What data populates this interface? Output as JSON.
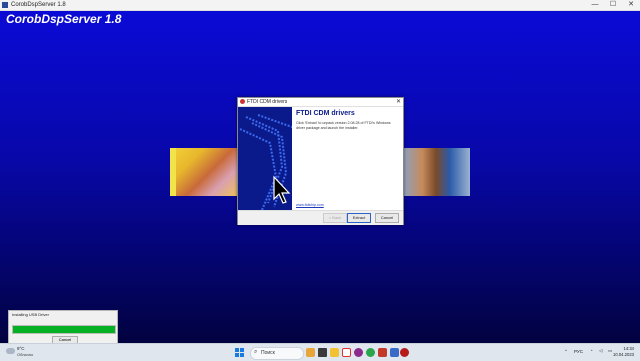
{
  "window": {
    "title": "CorobDspServer  1.8",
    "minimize": "—",
    "maximize": "☐",
    "close": "✕"
  },
  "desktop": {
    "app_name": "CorobDspServer  1.8"
  },
  "dialog": {
    "title": "FTDI CDM drivers",
    "close": "✕",
    "heading": "FTDI CDM drivers",
    "body": "Click 'Extract' to unpack version 2.08.28 of FTDI's Windows driver package and launch the installer.",
    "link": "www.ftdichip.com",
    "back_label": "< Back",
    "extract_label": "Extract",
    "cancel_label": "Cancel"
  },
  "installer": {
    "label": "Installing USB Driver",
    "progress": 1.0,
    "cancel_label": "Cancel"
  },
  "taskbar": {
    "weather_temp": "9°C",
    "weather_desc": "Облачно",
    "search_placeholder": "Поиск",
    "language": "РУС",
    "time": "14:34",
    "date": "10.04.2023",
    "accent": "#0a1a8a",
    "progress_color": "#06b025"
  }
}
